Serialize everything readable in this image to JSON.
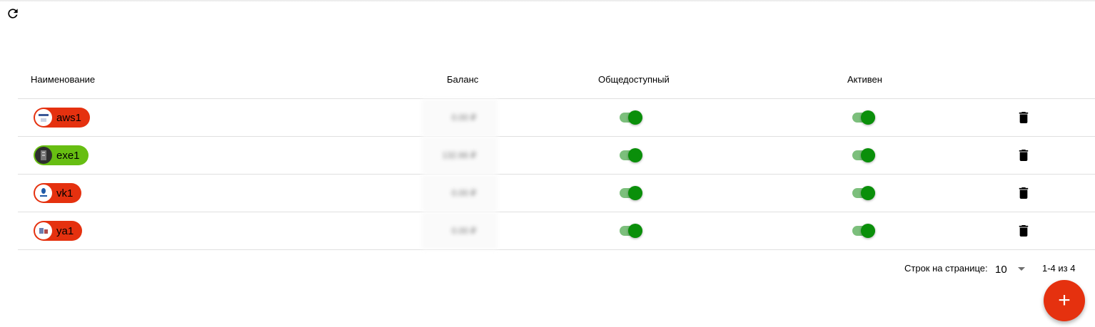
{
  "toolbar": {
    "refresh_icon": "refresh-icon"
  },
  "table": {
    "headers": {
      "name": "Наименование",
      "balance": "Баланс",
      "public": "Общедоступный",
      "active": "Активен"
    },
    "rows": [
      {
        "name": "aws1",
        "chip_color": "#e5310f",
        "balance": "0.00 ₽",
        "public": true,
        "active": true
      },
      {
        "name": "exe1",
        "chip_color": "#67be12",
        "balance": "132.66 ₽",
        "public": true,
        "active": true
      },
      {
        "name": "vk1",
        "chip_color": "#e5310f",
        "balance": "0.00 ₽",
        "public": true,
        "active": true
      },
      {
        "name": "ya1",
        "chip_color": "#e5310f",
        "balance": "0.00 ₽",
        "public": true,
        "active": true
      }
    ]
  },
  "pagination": {
    "rows_per_page_label": "Строк на странице:",
    "rows_per_page_value": "10",
    "range_text": "1-4 из 4"
  },
  "fab": {
    "label": "+"
  },
  "colors": {
    "accent": "#e5310f",
    "switch_on": "#0a8f0a",
    "chip_green": "#67be12"
  }
}
